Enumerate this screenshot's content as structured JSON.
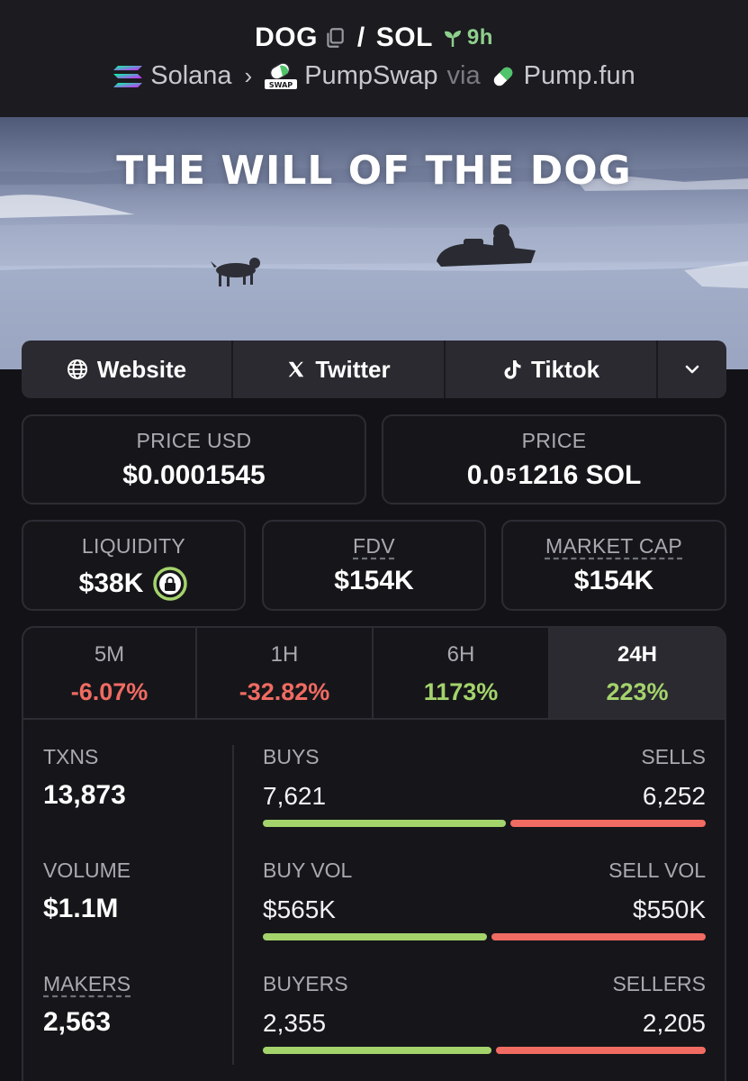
{
  "header": {
    "token": "DOG",
    "quote": "SOL",
    "separator": "/",
    "age": "9h",
    "chain": "Solana",
    "dex": "PumpSwap",
    "via_label": "via",
    "launchpad": "Pump.fun"
  },
  "banner": {
    "title": "THE WILL OF THE DOG"
  },
  "socials": {
    "website": "Website",
    "twitter": "Twitter",
    "tiktok": "Tiktok"
  },
  "stats": {
    "price_usd_label": "PRICE USD",
    "price_usd": "$0.0001545",
    "price_label": "PRICE",
    "price_prefix": "0.0",
    "price_zeros": "5",
    "price_suffix": "1216 SOL",
    "liquidity_label": "LIQUIDITY",
    "liquidity": "$38K",
    "fdv_label": "FDV",
    "fdv": "$154K",
    "mcap_label": "MARKET CAP",
    "mcap": "$154K"
  },
  "timeframes": [
    {
      "label": "5M",
      "change": "-6.07%",
      "direction": "down"
    },
    {
      "label": "1H",
      "change": "-32.82%",
      "direction": "down"
    },
    {
      "label": "6H",
      "change": "1173%",
      "direction": "up"
    },
    {
      "label": "24H",
      "change": "223%",
      "direction": "up",
      "active": true
    }
  ],
  "activity": {
    "txns_label": "TXNS",
    "txns": "13,873",
    "volume_label": "VOLUME",
    "volume": "$1.1M",
    "makers_label": "MAKERS",
    "makers": "2,563",
    "buys_label": "BUYS",
    "buys": "7,621",
    "sells_label": "SELLS",
    "sells": "6,252",
    "buy_vol_label": "BUY VOL",
    "buy_vol": "$565K",
    "sell_vol_label": "SELL VOL",
    "sell_vol": "$550K",
    "buyers_label": "BUYERS",
    "buyers": "2,355",
    "sellers_label": "SELLERS",
    "sellers": "2,205",
    "buy_ratio_txns": 0.549,
    "buy_ratio_vol": 0.507,
    "buy_ratio_makers": 0.516
  },
  "colors": {
    "positive": "#a4d36c",
    "negative": "#f06b62",
    "accent_green": "#8fd08c"
  }
}
